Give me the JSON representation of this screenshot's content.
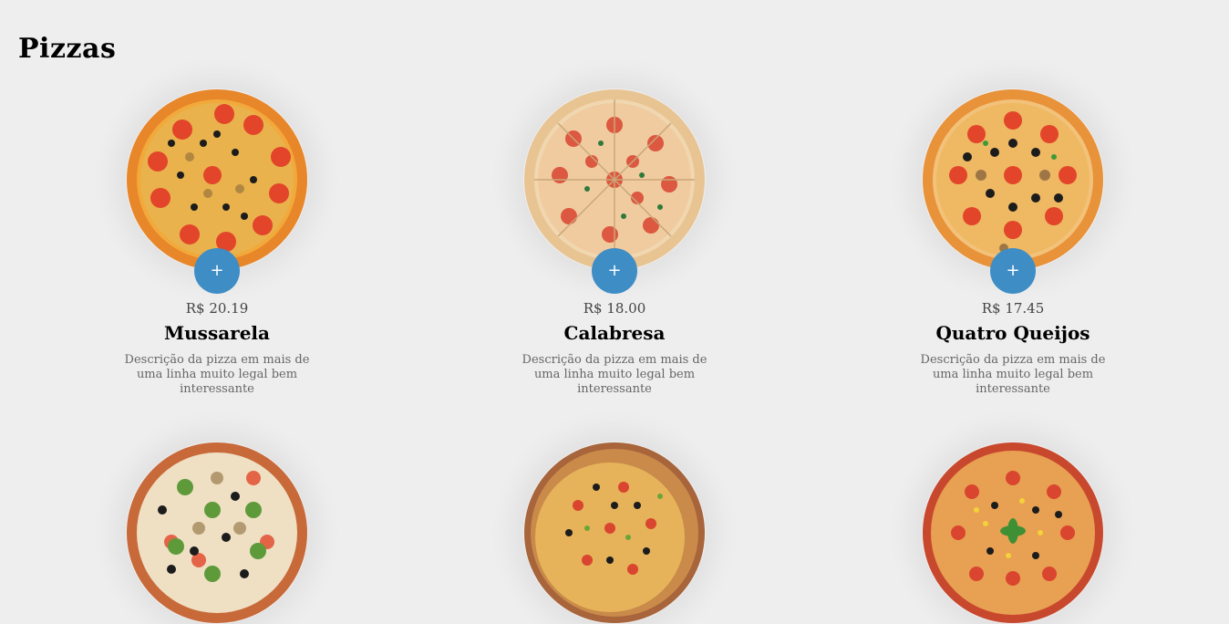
{
  "page": {
    "title": "Pizzas"
  },
  "colors": {
    "background": "#eeeeee",
    "add_button": "#3e8dc5"
  },
  "pizzas": [
    {
      "name": "Mussarela",
      "price": "R$ 20.19",
      "description": "Descrição da pizza em mais de uma linha muito legal bem interessante",
      "add_label": "+"
    },
    {
      "name": "Calabresa",
      "price": "R$ 18.00",
      "description": "Descrição da pizza em mais de uma linha muito legal bem interessante",
      "add_label": "+"
    },
    {
      "name": "Quatro Queijos",
      "price": "R$ 17.45",
      "description": "Descrição da pizza em mais de uma linha muito legal bem interessante",
      "add_label": "+"
    },
    {
      "name": "",
      "price": "",
      "description": "",
      "add_label": ""
    },
    {
      "name": "",
      "price": "",
      "description": "",
      "add_label": ""
    },
    {
      "name": "",
      "price": "",
      "description": "",
      "add_label": ""
    }
  ]
}
